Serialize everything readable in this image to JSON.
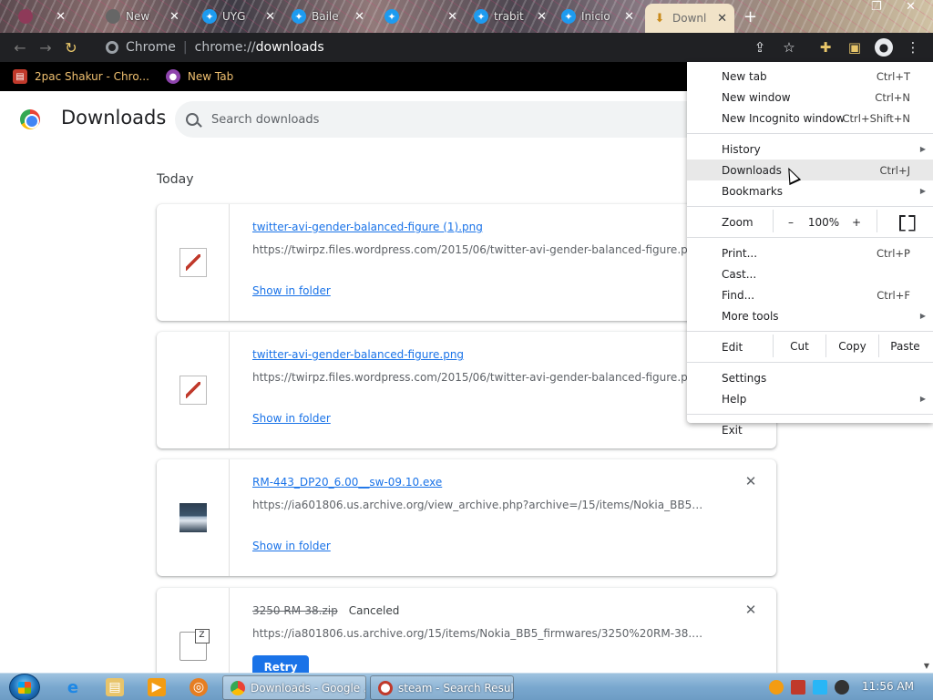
{
  "browser": {
    "tabs": [
      {
        "title": "",
        "icon": "chrome-icon"
      },
      {
        "title": "New",
        "icon": "chrome-icon"
      },
      {
        "title": "UYG",
        "icon": "twitter-icon"
      },
      {
        "title": "Baile",
        "icon": "twitter-icon"
      },
      {
        "title": "",
        "icon": "twitter-icon"
      },
      {
        "title": "trabit",
        "icon": "twitter-icon"
      },
      {
        "title": "Inicio",
        "icon": "twitter-icon"
      },
      {
        "title": "Downl",
        "icon": "download-icon",
        "active": true
      }
    ],
    "omnibox": {
      "scheme_label": "Chrome",
      "url_prefix": "chrome://",
      "url_host": "downloads"
    },
    "bookmarks": [
      {
        "label": "2pac Shakur - Chro..."
      },
      {
        "label": "New Tab"
      }
    ]
  },
  "downloads": {
    "title": "Downloads",
    "search_placeholder": "Search downloads",
    "section": "Today",
    "items": [
      {
        "name": "twitter-avi-gender-balanced-figure (1).png",
        "url": "https://twirpz.files.wordpress.com/2015/06/twitter-avi-gender-balanced-figure.png",
        "action": "Show in folder"
      },
      {
        "name": "twitter-avi-gender-balanced-figure.png",
        "url": "https://twirpz.files.wordpress.com/2015/06/twitter-avi-gender-balanced-figure.png",
        "action": "Show in folder"
      },
      {
        "name": "RM-443_DP20_6.00__sw-09.10.exe",
        "url": "https://ia601806.us.archive.org/view_archive.php?archive=/15/items/Nokia_BB5_fir...",
        "action": "Show in folder"
      },
      {
        "name": "3250 RM-38.zip",
        "status": "Canceled",
        "url": "https://ia801806.us.archive.org/15/items/Nokia_BB5_firmwares/3250%20RM-38.zip",
        "action": "Retry"
      }
    ]
  },
  "menu": {
    "new_tab": {
      "label": "New tab",
      "shortcut": "Ctrl+T"
    },
    "new_window": {
      "label": "New window",
      "shortcut": "Ctrl+N"
    },
    "new_incognito": {
      "label": "New Incognito window",
      "shortcut": "Ctrl+Shift+N"
    },
    "history": {
      "label": "History"
    },
    "downloads": {
      "label": "Downloads",
      "shortcut": "Ctrl+J"
    },
    "bookmarks": {
      "label": "Bookmarks"
    },
    "zoom": {
      "label": "Zoom",
      "minus": "–",
      "value": "100%",
      "plus": "+"
    },
    "print": {
      "label": "Print...",
      "shortcut": "Ctrl+P"
    },
    "cast": {
      "label": "Cast..."
    },
    "find": {
      "label": "Find...",
      "shortcut": "Ctrl+F"
    },
    "more_tools": {
      "label": "More tools"
    },
    "edit": {
      "label": "Edit",
      "cut": "Cut",
      "copy": "Copy",
      "paste": "Paste"
    },
    "settings": {
      "label": "Settings"
    },
    "help": {
      "label": "Help"
    },
    "exit": {
      "label": "Exit"
    }
  },
  "taskbar": {
    "windows": [
      {
        "label": "Downloads - Google ...",
        "active": true
      },
      {
        "label": "steam - Search Results",
        "active": false
      }
    ],
    "clock": "11:56 AM"
  },
  "colors": {
    "accent": "#1a73e8",
    "toolbar": "#202124",
    "bookmark_text": "#f0c070"
  }
}
